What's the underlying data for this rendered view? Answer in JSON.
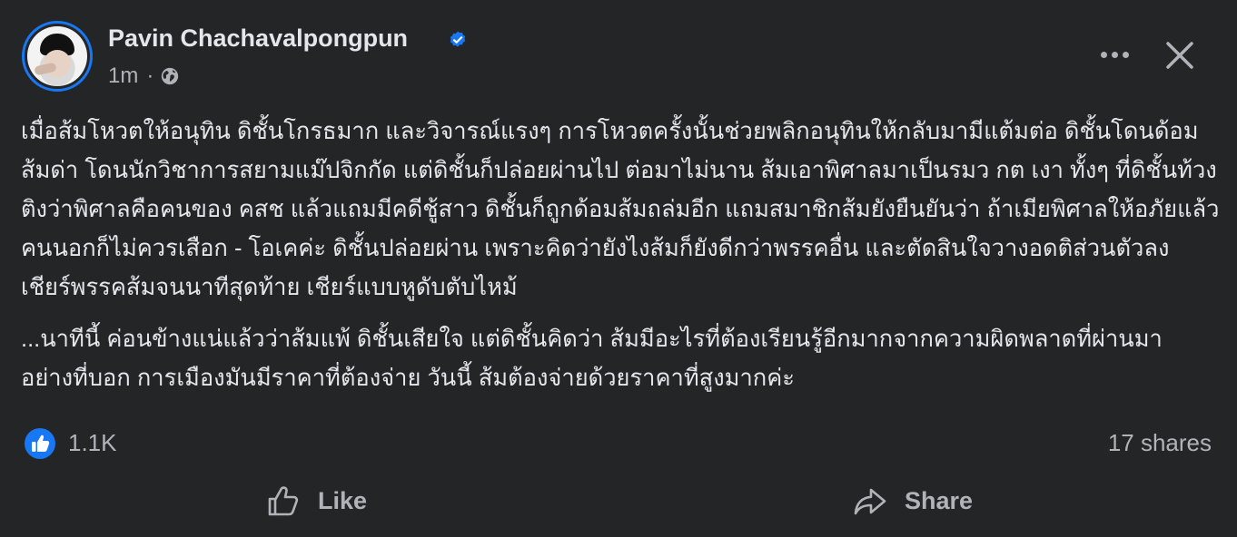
{
  "post": {
    "author": "Pavin Chachavalpongpun",
    "time": "1m",
    "separator": "·",
    "paragraphs": [
      "เมื่อส้มโหวตให้อนุทิน ดิชั้นโกรธมาก และวิจารณ์แรงๆ การโหวตครั้งนั้นช่วยพลิกอนุทินให้กลับมามีแต้มต่อ ดิชั้นโดนด้อมส้มด่า โดนนักวิชาการสยามแม๊ปจิกกัด แต่ดิชั้นก็ปล่อยผ่านไป ต่อมาไม่นาน ส้มเอาพิศาลมาเป็นรมว กต เงา ทั้งๆ ที่ดิชั้นท้วงติงว่าพิศาลคือคนของ คสช แล้วแถมมีคดีชู้สาว ดิชั้นก็ถูกด้อมส้มถล่มอีก แถมสมาชิกส้มยังยืนยันว่า ถ้าเมียพิศาลให้อภัยแล้ว คนนอกก็ไม่ควรเสือก - โอเคค่ะ ดิชั้นปล่อยผ่าน เพราะคิดว่ายังไงส้มก็ยังดีกว่าพรรคอื่น และตัดสินใจวางอดติส่วนตัวลง เชียร์พรรคส้มจนนาทีสุดท้าย เชียร์แบบหูดับตับไหม้",
      "...นาทีนี้ ค่อนข้างแน่แล้วว่าส้มแพ้ ดิชั้นเสียใจ แต่ดิชั้นคิดว่า ส้มมีอะไรที่ต้องเรียนรู้อีกมากจากความผิดพลาดที่ผ่านมา อย่างที่บอก การเมืองมันมีราคาที่ต้องจ่าย วันนี้ ส้มต้องจ่ายด้วยราคาที่สูงมากค่ะ"
    ],
    "reactions_count": "1.1K",
    "shares": "17 shares"
  },
  "actions": {
    "like_label": "Like",
    "share_label": "Share"
  },
  "icons": {
    "verified": "verified-badge-icon",
    "audience": "globe-icon",
    "more": "more-options-icon",
    "close": "close-icon",
    "reaction": "like-reaction-icon",
    "like": "thumbs-up-icon",
    "share": "share-arrow-icon"
  },
  "colors": {
    "background": "#242526",
    "text": "#e4e6eb",
    "secondary_text": "#b0b3b8",
    "accent": "#1877f2"
  }
}
